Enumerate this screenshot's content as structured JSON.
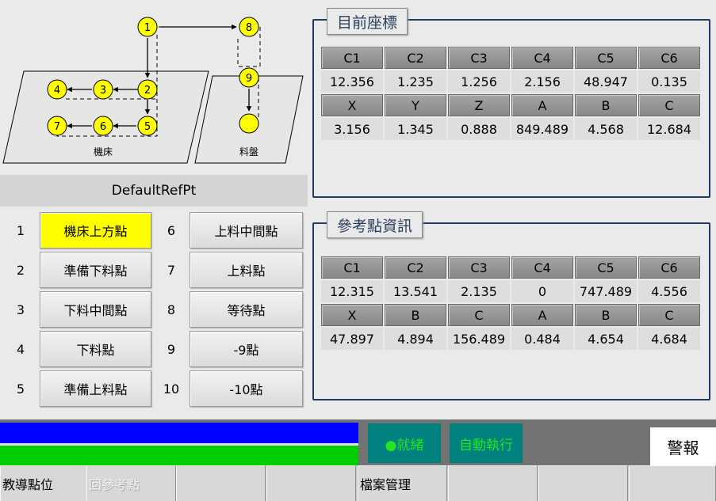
{
  "diagram": {
    "machine_label": "機床",
    "tray_label": "料盤",
    "nodes": [
      "1",
      "2",
      "3",
      "4",
      "5",
      "6",
      "7",
      "8",
      "9"
    ]
  },
  "ref_header": "DefaultRefPt",
  "points": [
    {
      "num": "1",
      "label": "機床上方點"
    },
    {
      "num": "2",
      "label": "準備下料點"
    },
    {
      "num": "3",
      "label": "下料中間點"
    },
    {
      "num": "4",
      "label": "下料點"
    },
    {
      "num": "5",
      "label": "準備上料點"
    },
    {
      "num": "6",
      "label": "上料中間點"
    },
    {
      "num": "7",
      "label": "上料點"
    },
    {
      "num": "8",
      "label": "等待點"
    },
    {
      "num": "9",
      "label": "-9點"
    },
    {
      "num": "10",
      "label": "-10點"
    }
  ],
  "current": {
    "title": "目前座標",
    "rows": [
      [
        "C1",
        "C2",
        "C3",
        "C4",
        "C5",
        "C6"
      ],
      [
        "12.356",
        "1.235",
        "1.256",
        "2.156",
        "48.947",
        "0.135"
      ],
      [
        "X",
        "Y",
        "Z",
        "A",
        "B",
        "C"
      ],
      [
        "3.156",
        "1.345",
        "0.888",
        "849.489",
        "4.568",
        "12.684"
      ]
    ]
  },
  "reference": {
    "title": "參考點資訊",
    "rows": [
      [
        "C1",
        "C2",
        "C3",
        "C4",
        "C5",
        "C6"
      ],
      [
        "12.315",
        "13.541",
        "2.135",
        "0",
        "747.489",
        "4.556"
      ],
      [
        "X",
        "B",
        "C",
        "A",
        "B",
        "C"
      ],
      [
        "47.897",
        "4.894",
        "156.489",
        "0.484",
        "4.654",
        "4.684"
      ]
    ]
  },
  "status": {
    "ready": "●就緒",
    "auto_run": "自動執行",
    "alarm": "警報"
  },
  "bottom": [
    "教導點位",
    "回參考點",
    "",
    "",
    "檔案管理",
    "",
    "",
    ""
  ],
  "colors": {
    "active_point": "#ffff00",
    "frame": "#1f3864",
    "status_tile": "#00807f",
    "status_text": "#22e622",
    "bar_blue": "#0000ff",
    "bar_green": "#00cc00"
  }
}
